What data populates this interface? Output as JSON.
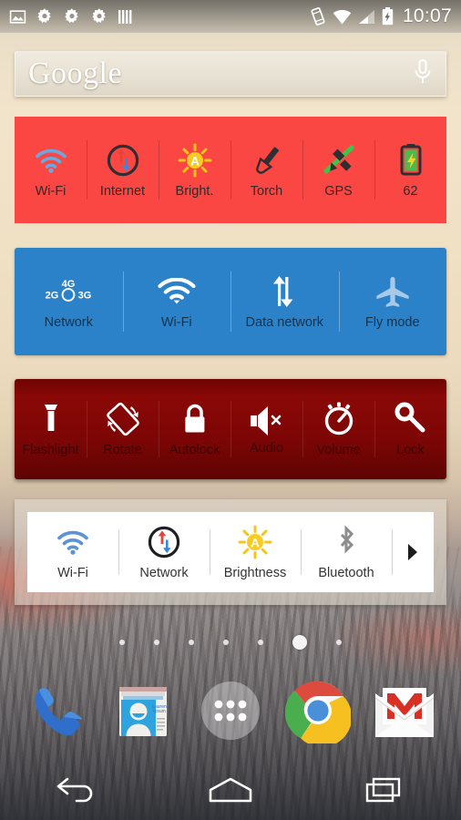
{
  "status_bar": {
    "left_icons": [
      "image-icon",
      "gear-icon",
      "gear-icon",
      "gear-icon",
      "bars-icon"
    ],
    "right_icons": [
      "vibrate-icon",
      "wifi-icon",
      "signal-icon",
      "battery-charging-icon"
    ],
    "clock": "10:07"
  },
  "search": {
    "brand": "Google",
    "mic": "microphone-icon"
  },
  "widgets": [
    {
      "id": "red-toggle-widget",
      "color": "#fb4743",
      "items": [
        {
          "label": "Wi-Fi",
          "icon": "wifi-icon"
        },
        {
          "label": "Internet",
          "icon": "data-sync-icon"
        },
        {
          "label": "Bright.",
          "icon": "brightness-auto-icon"
        },
        {
          "label": "Torch",
          "icon": "torch-icon"
        },
        {
          "label": "GPS",
          "icon": "gps-satellite-icon"
        },
        {
          "label": "62",
          "icon": "battery-charging-icon"
        }
      ]
    },
    {
      "id": "blue-toggle-widget",
      "color": "#2c82c9",
      "items": [
        {
          "label": "Network",
          "icon": "network-2g-3g-4g-icon",
          "icon_text": {
            "top": "4G",
            "left": "2G",
            "right": "3G"
          }
        },
        {
          "label": "Wi-Fi",
          "icon": "wifi-icon"
        },
        {
          "label": "Data network",
          "icon": "data-arrows-icon"
        },
        {
          "label": "Fly mode",
          "icon": "airplane-icon"
        }
      ]
    },
    {
      "id": "dark-red-toggle-widget",
      "color": "#7a0605",
      "items": [
        {
          "label": "Flashlight",
          "icon": "flashlight-icon"
        },
        {
          "label": "Rotate",
          "icon": "auto-rotate-icon"
        },
        {
          "label": "Autolock",
          "icon": "lock-icon"
        },
        {
          "label": "Audio",
          "icon": "speaker-mute-icon"
        },
        {
          "label": "Volume",
          "icon": "volume-dial-icon"
        },
        {
          "label": "Lock",
          "icon": "key-icon"
        }
      ]
    },
    {
      "id": "white-toggle-widget",
      "color": "#ffffff",
      "items": [
        {
          "label": "Wi-Fi",
          "icon": "wifi-icon"
        },
        {
          "label": "Network",
          "icon": "data-sync-icon"
        },
        {
          "label": "Brightness",
          "icon": "brightness-auto-icon"
        },
        {
          "label": "Bluetooth",
          "icon": "bluetooth-icon"
        }
      ],
      "more": "next-arrow-icon"
    }
  ],
  "page_indicator": {
    "count": 7,
    "active_index": 5
  },
  "dock": [
    {
      "label": "Phone",
      "icon": "phone-icon"
    },
    {
      "label": "Contacts",
      "icon": "contacts-icon"
    },
    {
      "label": "Apps",
      "icon": "app-drawer-icon"
    },
    {
      "label": "Chrome",
      "icon": "chrome-icon"
    },
    {
      "label": "Gmail",
      "icon": "gmail-icon"
    }
  ],
  "nav_bar": [
    {
      "label": "Back",
      "icon": "back-arrow-icon"
    },
    {
      "label": "Home",
      "icon": "home-icon"
    },
    {
      "label": "Recents",
      "icon": "recents-icon"
    }
  ]
}
